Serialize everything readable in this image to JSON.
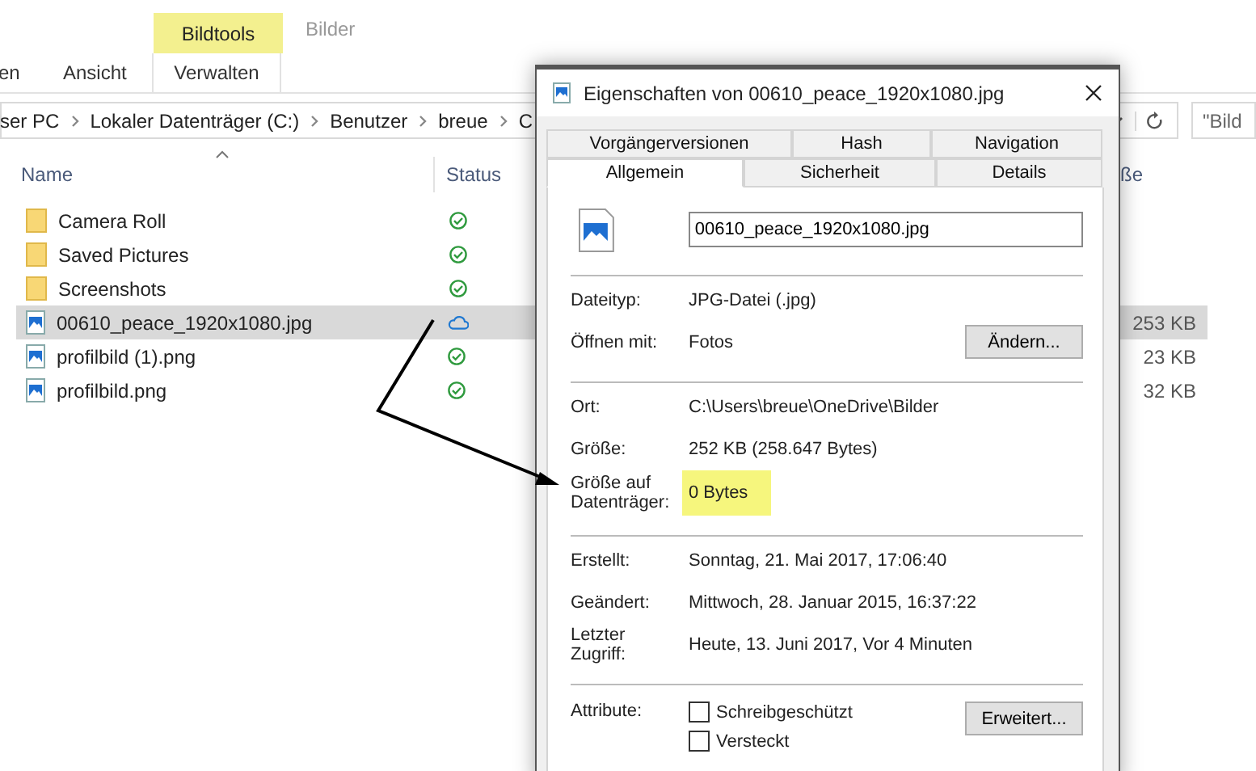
{
  "ribbon": {
    "context_group": "Bildtools",
    "window_title": "Bilder",
    "tabs": [
      {
        "label": "en",
        "selected": false
      },
      {
        "label": "Ansicht",
        "selected": false
      },
      {
        "label": "Verwalten",
        "selected": false
      }
    ]
  },
  "address_bar": {
    "crumbs": [
      "ser PC",
      "Lokaler Datenträger (C:)",
      "Benutzer",
      "breue",
      "C"
    ]
  },
  "search": {
    "placeholder": "\"Bild"
  },
  "columns": [
    "Name",
    "Status",
    "ße"
  ],
  "files": [
    {
      "name": "Camera Roll",
      "kind": "folder",
      "status": {
        "kind": "synced"
      },
      "selected": false
    },
    {
      "name": "Saved Pictures",
      "kind": "folder",
      "status": {
        "kind": "synced"
      },
      "selected": false
    },
    {
      "name": "Screenshots",
      "kind": "folder",
      "status": {
        "kind": "synced"
      },
      "selected": false
    },
    {
      "name": "00610_peace_1920x1080.jpg",
      "kind": "image",
      "status": {
        "kind": "cloud"
      },
      "size": "253 KB",
      "selected": true
    },
    {
      "name": "profilbild (1).png",
      "kind": "image",
      "status": {
        "kind": "synced"
      },
      "size": "23 KB",
      "selected": false
    },
    {
      "name": "profilbild.png",
      "kind": "image",
      "status": {
        "kind": "synced"
      },
      "size": "32 KB",
      "selected": false
    }
  ],
  "dialog": {
    "title": "Eigenschaften von 00610_peace_1920x1080.jpg",
    "tab_rows": [
      [
        {
          "label": "Vorgängerversionen",
          "selected": false
        },
        {
          "label": "Hash",
          "selected": false
        },
        {
          "label": "Navigation",
          "selected": false
        }
      ],
      [
        {
          "label": "Allgemein",
          "selected": true
        },
        {
          "label": "Sicherheit",
          "selected": false
        },
        {
          "label": "Details",
          "selected": false
        }
      ]
    ],
    "filename": "00610_peace_1920x1080.jpg",
    "groups": [
      [
        {
          "label": "Dateityp:",
          "value": "JPG-Datei (.jpg)",
          "highlighted": false
        },
        {
          "label": "Öffnen mit:",
          "value": "Fotos",
          "highlighted": false,
          "button": "Ändern..."
        }
      ],
      [
        {
          "label": "Ort:",
          "value": "C:\\Users\\breue\\OneDrive\\Bilder",
          "highlighted": false
        },
        {
          "label": "Größe:",
          "value": "252 KB (258.647 Bytes)",
          "highlighted": false
        },
        {
          "label": "Größe auf Datenträger:",
          "value": "0 Bytes",
          "highlighted": true
        }
      ],
      [
        {
          "label": "Erstellt:",
          "value": "Sonntag, 21. Mai 2017, 17:06:40",
          "highlighted": false
        },
        {
          "label": "Geändert:",
          "value": "Mittwoch, 28. Januar 2015, 16:37:22",
          "highlighted": false
        },
        {
          "label": "Letzter Zugriff:",
          "value": "Heute, 13. Juni 2017, Vor 4 Minuten",
          "highlighted": false
        }
      ]
    ],
    "attributes": {
      "label": "Attribute:",
      "options": [
        {
          "label": "Schreibgeschützt",
          "checked": false
        },
        {
          "label": "Versteckt",
          "checked": false
        }
      ],
      "button": "Erweitert..."
    }
  }
}
